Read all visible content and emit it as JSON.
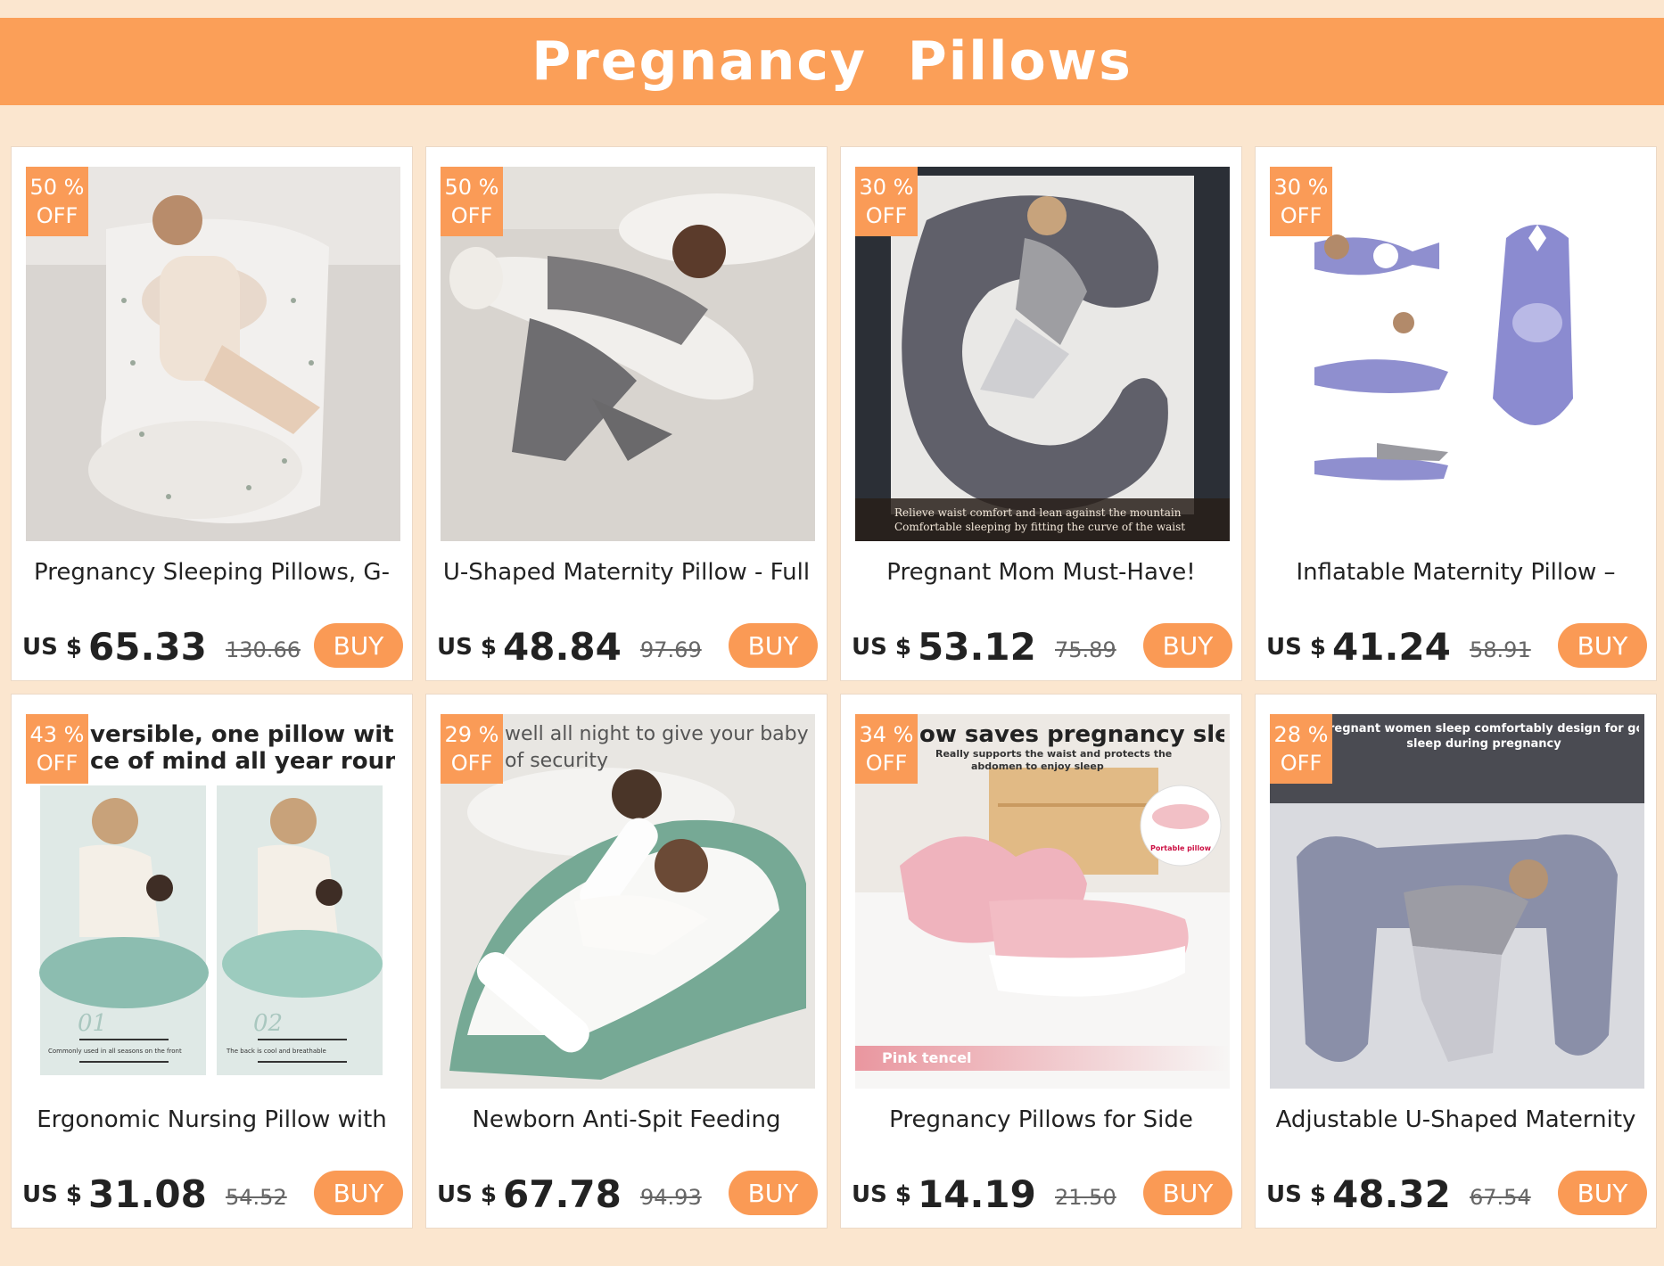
{
  "page": {
    "title": "Pregnancy  Pillows"
  },
  "products": [
    {
      "discount": "50 %",
      "off": "OFF",
      "title": "Pregnancy Sleeping Pillows, G-",
      "currency": "US $",
      "price": "65.33",
      "old_price": "130.66",
      "buy": "BUY",
      "overlay": ""
    },
    {
      "discount": "50 %",
      "off": "OFF",
      "title": "U-Shaped Maternity Pillow - Full",
      "currency": "US $",
      "price": "48.84",
      "old_price": "97.69",
      "buy": "BUY",
      "overlay": ""
    },
    {
      "discount": "30 %",
      "off": "OFF",
      "title": "Pregnant Mom Must-Have!",
      "currency": "US $",
      "price": "53.12",
      "old_price": "75.89",
      "buy": "BUY",
      "overlay": "",
      "caption": [
        "Relieve waist comfort and lean against the mountain",
        "Comfortable sleeping by fitting the curve of the waist"
      ]
    },
    {
      "discount": "30 %",
      "off": "OFF",
      "title": "Inflatable Maternity Pillow –",
      "currency": "US $",
      "price": "41.24",
      "old_price": "58.91",
      "buy": "BUY",
      "overlay": ""
    },
    {
      "discount": "43 %",
      "off": "OFF",
      "title": "Ergonomic Nursing Pillow with",
      "currency": "US $",
      "price": "31.08",
      "old_price": "54.52",
      "buy": "BUY",
      "overlay": [
        "versible, one pillow with",
        "ce of mind all year round"
      ],
      "panel_labels": [
        "01",
        "02"
      ],
      "panel_captions": [
        "Commonly used in all seasons on the front",
        "The back is cool and breathable"
      ]
    },
    {
      "discount": "29 %",
      "off": "OFF",
      "title": "Newborn Anti-Spit Feeding",
      "currency": "US $",
      "price": "67.78",
      "old_price": "94.93",
      "buy": "BUY",
      "overlay": [
        "well all night to give your baby a",
        "of security"
      ]
    },
    {
      "discount": "34 %",
      "off": "OFF",
      "title": "Pregnancy Pillows for Side",
      "currency": "US $",
      "price": "14.19",
      "old_price": "21.50",
      "buy": "BUY",
      "overlay": [
        "ow saves pregnancy sleep"
      ],
      "subtext": [
        "Really supports the waist and protects the",
        "abdomen to enjoy sleep"
      ],
      "inset_label": "Portable pillow",
      "tag": "Pink tencel"
    },
    {
      "discount": "28 %",
      "off": "OFF",
      "title": "Adjustable U-Shaped Maternity",
      "currency": "US $",
      "price": "48.32",
      "old_price": "67.54",
      "buy": "BUY",
      "overlay": [
        "regnant women sleep comfortably design for good",
        "sleep during pregnancy"
      ]
    }
  ],
  "colors": {
    "banner": "#fb9f58",
    "accent": "#fa9a55",
    "background": "#fbe6cf"
  }
}
